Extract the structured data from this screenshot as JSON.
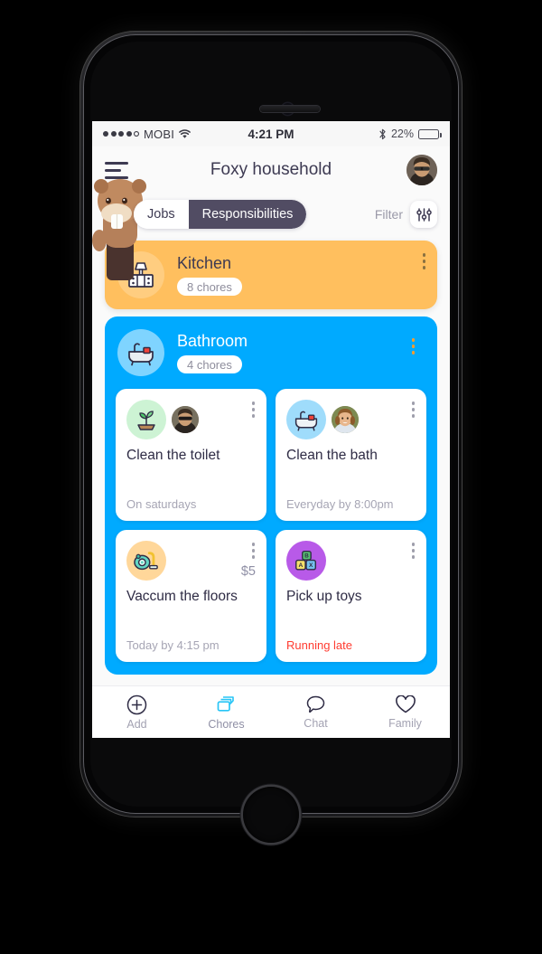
{
  "device": {
    "name": "iphone-black",
    "camera_icon": "camera-icon",
    "speaker_icon": "speaker-grille",
    "home_button": "home-button"
  },
  "status_bar": {
    "signal_dots_filled": 4,
    "signal_dots_total": 5,
    "carrier": "MOBI",
    "wifi_icon": "wifi-icon",
    "time": "4:21 PM",
    "bluetooth_icon": "bluetooth-icon",
    "battery_percent": "22%",
    "battery_level": 22
  },
  "header": {
    "menu_icon": "hamburger-menu-icon",
    "title": "Foxy household",
    "avatar": "user-avatar"
  },
  "tabs": {
    "items": [
      {
        "label": "Jobs",
        "active": false
      },
      {
        "label": "Responsibilities",
        "active": true
      }
    ],
    "filter_label": "Filter",
    "filter_icon": "sliders-filter-icon",
    "mascot_icon": "beaver-mascot"
  },
  "groups": [
    {
      "title": "Kitchen",
      "chore_count": "8 chores",
      "icon": "kitchen-stove-icon",
      "color": "#ffbf5e",
      "menu_icon": "kebab-menu-icon"
    },
    {
      "title": "Bathroom",
      "chore_count": "4 chores",
      "icon": "bathtub-icon",
      "color": "#00aaff",
      "menu_icon": "kebab-menu-icon",
      "chores": [
        {
          "name": "Clean the toilet",
          "meta": "On saturdays",
          "meta_state": "normal",
          "icon": "plant-seedling-icon",
          "icon_bg": "#cdf3d4",
          "assignee_avatar": "avatar-man-sunglasses",
          "price": "",
          "menu_icon": "kebab-menu-icon"
        },
        {
          "name": "Clean the bath",
          "meta": "Everyday by 8:00pm",
          "meta_state": "normal",
          "icon": "bathtub-icon",
          "icon_bg": "#9fdcfb",
          "assignee_avatar": "avatar-girl-smiling",
          "price": "",
          "menu_icon": "kebab-menu-icon"
        },
        {
          "name": "Vaccum the floors",
          "meta": "Today by 4:15 pm",
          "meta_state": "normal",
          "icon": "vacuum-cleaner-icon",
          "icon_bg": "#ffd79a",
          "assignee_avatar": "",
          "price": "$5",
          "menu_icon": "kebab-menu-icon"
        },
        {
          "name": "Pick up toys",
          "meta": "Running late",
          "meta_state": "late",
          "icon": "toy-blocks-icon",
          "icon_bg": "#b85ae8",
          "assignee_avatar": "",
          "price": "",
          "menu_icon": "kebab-menu-icon"
        }
      ]
    }
  ],
  "bottom_nav": {
    "items": [
      {
        "label": "Add",
        "icon": "plus-circle-icon",
        "active": false
      },
      {
        "label": "Chores",
        "icon": "stacked-cards-icon",
        "active": true
      },
      {
        "label": "Chat",
        "icon": "speech-bubble-icon",
        "active": false
      },
      {
        "label": "Family",
        "icon": "heart-icon",
        "active": false
      }
    ],
    "active_color": "#29c5f6"
  }
}
